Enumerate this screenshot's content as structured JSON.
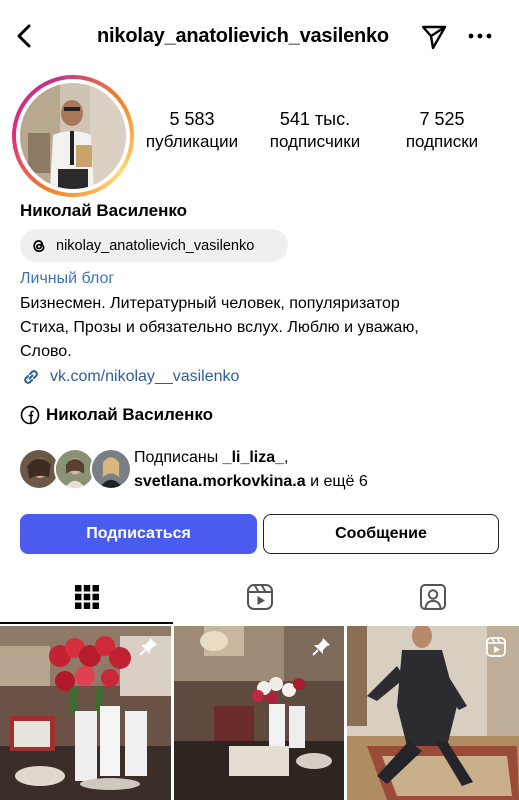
{
  "header": {
    "username": "nikolay_anatolievich_vasilenko",
    "back_icon": "chevron-left-icon",
    "send_icon": "paper-plane-icon",
    "more_icon": "more-horizontal-icon"
  },
  "profile": {
    "stats": [
      {
        "value": "5 583",
        "label": "публикации"
      },
      {
        "value": "541 тыс.",
        "label": "подписчики"
      },
      {
        "value": "7 525",
        "label": "подписки"
      }
    ],
    "display_name": "Николай Василенко",
    "threads_handle": "nikolay_anatolievich_vasilenko",
    "category": "Личный блог",
    "bio_lines": [
      "Бизнесмен. Литературный человек, популяризатор",
      "Стиха, Прозы и обязательно вслух. Люблю и уважаю,",
      "Слово."
    ],
    "link": "vk.com/nikolay__vasilenko",
    "facebook_name": "Николай Василенко",
    "followed_by": {
      "prefix": "Подписаны ",
      "user1": "_li_liza_",
      "sep": ",",
      "user2": "svetlana.morkovkina.a",
      "suffix": " и ещё 6"
    }
  },
  "actions": {
    "follow_label": "Подписаться",
    "message_label": "Сообщение"
  },
  "tabs": [
    {
      "icon": "grid-icon",
      "active": true
    },
    {
      "icon": "reels-icon",
      "active": false
    },
    {
      "icon": "tagged-icon",
      "active": false
    }
  ],
  "posts": [
    {
      "badge": "pin-icon"
    },
    {
      "badge": "pin-icon"
    },
    {
      "badge": "reels-icon"
    }
  ],
  "colors": {
    "follow_button": "#4a5cf0",
    "link": "#2f5e98",
    "category": "#3a74b8"
  }
}
